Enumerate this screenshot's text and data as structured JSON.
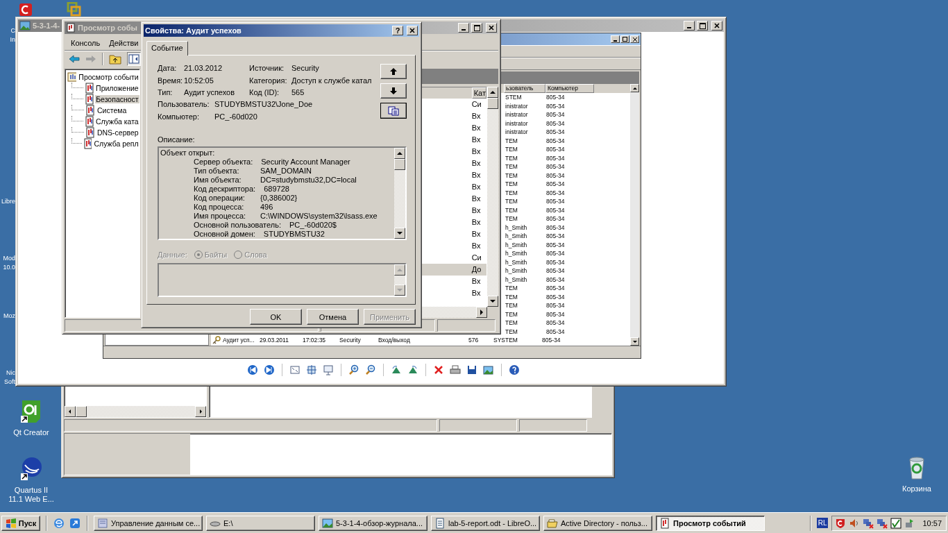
{
  "desktop_labels": [
    {
      "lines": [
        "C",
        "In"
      ]
    },
    {
      "lines": [
        "Libre"
      ]
    },
    {
      "lines": [
        "Mod",
        "10.0"
      ]
    },
    {
      "lines": [
        "Moz"
      ]
    },
    {
      "lines": [
        "Nic",
        "Soft"
      ]
    }
  ],
  "shortcuts": [
    {
      "kind": "qt",
      "lines": [
        "Qt Creator"
      ]
    },
    {
      "kind": "quartus",
      "lines": [
        "Quartus II",
        "11.1 Web E..."
      ]
    },
    {
      "kind": "recycle",
      "lines": [
        "Корзина"
      ]
    }
  ],
  "image_viewer": {
    "title": "5-3-1-4-",
    "screenshot": {
      "columns": [
        "ьзователь",
        "Компьютер"
      ],
      "rows": [
        {
          "kind": "partial",
          "user": "STEM",
          "computer": "805-34"
        },
        {
          "kind": "partial",
          "user": "inistrator",
          "computer": "805-34"
        },
        {
          "kind": "partial",
          "user": "inistrator",
          "computer": "805-34"
        },
        {
          "kind": "partial",
          "user": "inistrator",
          "computer": "805-34"
        },
        {
          "kind": "partial",
          "user": "inistrator",
          "computer": "805-34"
        },
        {
          "kind": "partial",
          "user": "TEM",
          "computer": "805-34"
        },
        {
          "kind": "partial",
          "user": "TEM",
          "computer": "805-34"
        },
        {
          "kind": "partial",
          "user": "TEM",
          "computer": "805-34"
        },
        {
          "kind": "partial",
          "user": "TEM",
          "computer": "805-34"
        },
        {
          "kind": "partial",
          "user": "TEM",
          "computer": "805-34"
        },
        {
          "kind": "partial",
          "user": "TEM",
          "computer": "805-34"
        },
        {
          "kind": "partial",
          "user": "TEM",
          "computer": "805-34"
        },
        {
          "kind": "partial",
          "user": "TEM",
          "computer": "805-34"
        },
        {
          "kind": "partial",
          "user": "TEM",
          "computer": "805-34"
        },
        {
          "kind": "partial",
          "user": "TEM",
          "computer": "805-34"
        },
        {
          "kind": "partial",
          "user": "h_Smith",
          "computer": "805-34"
        },
        {
          "kind": "partial",
          "user": "h_Smith",
          "computer": "805-34"
        },
        {
          "kind": "partial",
          "user": "h_Smith",
          "computer": "805-34"
        },
        {
          "kind": "partial",
          "user": "h_Smith",
          "computer": "805-34"
        },
        {
          "kind": "partial",
          "user": "h_Smith",
          "computer": "805-34"
        },
        {
          "kind": "partial",
          "user": "h_Smith",
          "computer": "805-34"
        },
        {
          "kind": "partial",
          "user": "h_Smith",
          "computer": "805-34"
        },
        {
          "kind": "partial",
          "user": "TEM",
          "computer": "805-34"
        },
        {
          "kind": "partial",
          "user": "TEM",
          "computer": "805-34"
        },
        {
          "kind": "partial",
          "user": "TEM",
          "computer": "805-34"
        },
        {
          "kind": "partial",
          "user": "TEM",
          "computer": "805-34"
        },
        {
          "kind": "partial",
          "user": "TEM",
          "computer": "805-34"
        },
        {
          "kind": "partial",
          "user": "TEM",
          "computer": "805-34"
        },
        {
          "kind": "full",
          "type": "Аудит усп...",
          "date": "29.03.2011",
          "time": "17:02:35",
          "source": "Security",
          "category": "Вход/выход",
          "event": "576",
          "user": "SYSTEM",
          "computer": "805-34"
        }
      ]
    }
  },
  "event_viewer": {
    "title": "Просмотр собы",
    "menu": [
      "Консоль",
      "Действи"
    ],
    "tree": {
      "label": "Просмотр событи",
      "children": [
        {
          "label": "Приложение",
          "selected": false
        },
        {
          "label": "Безопасност",
          "selected": true
        },
        {
          "label": "Система",
          "selected": false
        },
        {
          "label": "Служба ката",
          "selected": false
        },
        {
          "label": "DNS-сервер",
          "selected": false
        },
        {
          "label": "Служба репл",
          "selected": false
        }
      ]
    },
    "column": "Кат",
    "rows": [
      {
        "category": "Си",
        "selected": false
      },
      {
        "category": "Вх",
        "selected": false
      },
      {
        "category": "Вх",
        "selected": false
      },
      {
        "category": "Вх",
        "selected": false
      },
      {
        "category": "Вх",
        "selected": false
      },
      {
        "category": "Вх",
        "selected": false
      },
      {
        "category": "Вх",
        "selected": false
      },
      {
        "category": "Вх",
        "selected": false
      },
      {
        "category": "Вх",
        "selected": false
      },
      {
        "category": "Вх",
        "selected": false
      },
      {
        "category": "Вх",
        "selected": false
      },
      {
        "category": "Вх",
        "selected": false
      },
      {
        "category": "Вх",
        "selected": false
      },
      {
        "category": "Си",
        "selected": false
      },
      {
        "category": "До",
        "selected": true
      },
      {
        "category": "Вх",
        "selected": false
      },
      {
        "category": "Вх",
        "selected": false
      }
    ]
  },
  "dialog": {
    "title": "Свойства: Аудит успехов",
    "help_button": "?",
    "tabs": [
      {
        "label": "Событие",
        "selected": true
      }
    ],
    "grid_fields": [
      {
        "label": "Дата:",
        "value": "21.03.2012"
      },
      {
        "label": "Источник:",
        "value": "Security"
      },
      {
        "label": "Время:",
        "value": "10:52:05"
      },
      {
        "label": "Категория:",
        "value": "Доступ к службе катал"
      },
      {
        "label": "Тип:",
        "value": "Аудит успехов"
      },
      {
        "label": "Код (ID):",
        "value": "565"
      }
    ],
    "wide_fields": [
      {
        "label": "Пользователь:",
        "value": "STUDYBMSTU32\\Jone_Doe"
      },
      {
        "label": "Компьютер:",
        "value": "PC_-60d020"
      }
    ],
    "description_label": "Описание:",
    "description": {
      "heading": "Объект открыт:",
      "rows": [
        {
          "label": "Сервер объекта:",
          "value": "Security Account Manager"
        },
        {
          "label": "Тип объекта:",
          "value": "SAM_DOMAIN"
        },
        {
          "label": "Имя объекта:",
          "value": "DC=studybmstu32,DC=local"
        },
        {
          "label": "Код дескриптора:",
          "value": "689728"
        },
        {
          "label": "Код операции:",
          "value": "{0,386002}"
        },
        {
          "label": "Код процесса:",
          "value": "496"
        },
        {
          "label": "Имя процесса:",
          "value": "C:\\WINDOWS\\system32\\lsass.exe"
        },
        {
          "label": "Основной пользователь:",
          "value": "PC_-60d020$"
        },
        {
          "label": "Основной домен:",
          "value": "STUDYBMSTU32"
        }
      ]
    },
    "data_label": "Данные:",
    "data_disabled": true,
    "formats": [
      {
        "label": "Байты",
        "selected": true,
        "disabled": true
      },
      {
        "label": "Слова",
        "selected": false,
        "disabled": true
      }
    ],
    "buttons": [
      {
        "label": "OK",
        "disabled": false
      },
      {
        "label": "Отмена",
        "disabled": false
      },
      {
        "label": "Применить",
        "disabled": true
      }
    ]
  },
  "taskbar": {
    "start": "Пуск",
    "tasks": [
      {
        "label": "Управление данным се...",
        "selected": false,
        "kind": "server"
      },
      {
        "label": "E:\\",
        "selected": false,
        "kind": "drive"
      },
      {
        "label": "5-3-1-4-обзор-журнала...",
        "selected": false,
        "kind": "image"
      },
      {
        "label": "lab-5-report.odt - LibreO...",
        "selected": false,
        "kind": "doc"
      },
      {
        "label": "Active Directory - польз...",
        "selected": false,
        "kind": "ad"
      },
      {
        "label": "Просмотр событий",
        "selected": true,
        "kind": "log"
      }
    ],
    "language": "RL",
    "clock": "10:57"
  }
}
